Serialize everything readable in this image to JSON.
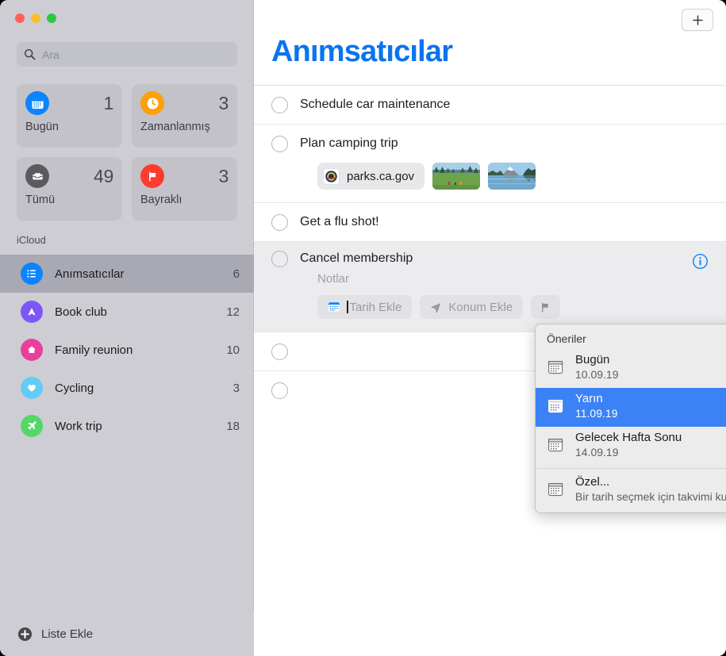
{
  "window": {
    "traffic_lights": [
      "close",
      "minimize",
      "zoom"
    ]
  },
  "sidebar": {
    "search": {
      "placeholder": "Ara",
      "value": "",
      "icon": "search-icon"
    },
    "smart_lists": [
      {
        "label": "Bugün",
        "count": "1",
        "icon": "calendar-icon",
        "color": "#0a84ff"
      },
      {
        "label": "Zamanlanmış",
        "count": "3",
        "icon": "clock-icon",
        "color": "#ff9f0a"
      },
      {
        "label": "Tümü",
        "count": "49",
        "icon": "inbox-icon",
        "color": "#5a5a60"
      },
      {
        "label": "Bayraklı",
        "count": "3",
        "icon": "flag-icon",
        "color": "#ff3b30"
      }
    ],
    "section_title": "iCloud",
    "lists": [
      {
        "label": "Anımsatıcılar",
        "count": "6",
        "icon": "list-bullet-icon",
        "color": "#0a84ff",
        "selected": true
      },
      {
        "label": "Book club",
        "count": "12",
        "icon": "person-icon",
        "color": "#7d56f5"
      },
      {
        "label": "Family reunion",
        "count": "10",
        "icon": "house-icon",
        "color": "#e8409a"
      },
      {
        "label": "Cycling",
        "count": "3",
        "icon": "heart-icon",
        "color": "#62ccf8"
      },
      {
        "label": "Work trip",
        "count": "18",
        "icon": "airplane-icon",
        "color": "#53d769"
      }
    ],
    "add_list": {
      "label": "Liste Ekle",
      "icon": "plus-circle-icon"
    }
  },
  "main": {
    "title": "Anımsatıcılar",
    "title_color": "#0a74f0",
    "add_button": {
      "icon": "plus-icon",
      "label": "+"
    },
    "reminders": [
      {
        "title": "Schedule car maintenance"
      },
      {
        "title": "Plan camping trip",
        "attachments": {
          "url": {
            "text": "parks.ca.gov",
            "icon": "park-seal-favicon"
          },
          "images": [
            "meadow-trees-photo",
            "mountain-lake-photo"
          ]
        }
      },
      {
        "title": "Get a flu shot!"
      },
      {
        "title": "Cancel membership",
        "notes_placeholder": "Notlar",
        "selected": true,
        "info_icon": "info-circle-icon",
        "chips": [
          {
            "label": "Tarih Ekle",
            "icon": "calendar-icon",
            "has_caret": true
          },
          {
            "label": "Konum Ekle",
            "icon": "location-arrow-icon",
            "has_caret": false
          },
          {
            "label": "",
            "icon": "flag-icon",
            "has_caret": false
          }
        ]
      },
      {
        "title": ""
      },
      {
        "title": ""
      }
    ]
  },
  "date_popup": {
    "header": "Öneriler",
    "items": [
      {
        "title": "Bugün",
        "date": "10.09.19",
        "icon": "calendar-icon",
        "selected": false
      },
      {
        "title": "Yarın",
        "date": "11.09.19",
        "icon": "calendar-icon",
        "selected": true
      },
      {
        "title": "Gelecek Hafta Sonu",
        "date": "14.09.19",
        "icon": "calendar-icon",
        "selected": false
      }
    ],
    "custom": {
      "title": "Özel...",
      "subtitle": "Bir tarih seçmek için takvimi kullanın.",
      "icon": "calendar-icon"
    },
    "highlight_color": "#3b82f6"
  }
}
